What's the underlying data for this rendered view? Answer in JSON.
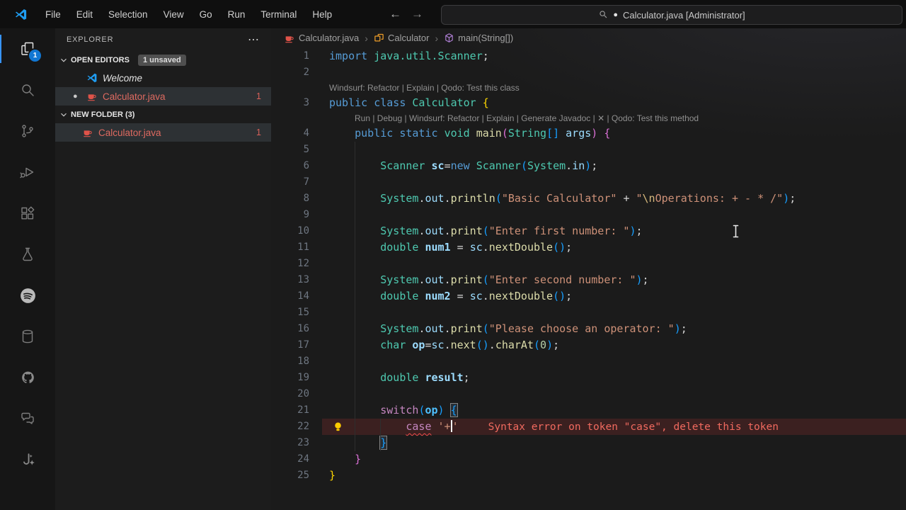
{
  "colors": {
    "accent_blue": "#3794ff",
    "badge_blue": "#1177d3",
    "error_red": "#f14c4c",
    "error_file": "#df6a60",
    "string_orange": "#ce9178",
    "keyword_blue": "#569cd6",
    "type_teal": "#4ec9b0"
  },
  "title_bar": {
    "menus": [
      "File",
      "Edit",
      "Selection",
      "View",
      "Go",
      "Run",
      "Terminal",
      "Help"
    ],
    "nav_back": "←",
    "nav_forward": "→",
    "search": {
      "icon": "search-icon",
      "dot": "●",
      "label": "Calculator.java [Administrator]"
    }
  },
  "activity_bar": {
    "items": [
      {
        "name": "explorer",
        "active": true,
        "badge": "1"
      },
      {
        "name": "search"
      },
      {
        "name": "source-control"
      },
      {
        "name": "run-debug"
      },
      {
        "name": "extensions"
      },
      {
        "name": "testing"
      },
      {
        "name": "spotify"
      },
      {
        "name": "database"
      },
      {
        "name": "github"
      },
      {
        "name": "comments"
      },
      {
        "name": "ai-assistant"
      }
    ]
  },
  "sidebar": {
    "title": "EXPLORER",
    "actions": "⋯",
    "open_editors": {
      "label": "OPEN EDITORS",
      "badge": "1 unsaved",
      "items": [
        {
          "label": "Welcome",
          "icon": "vscode",
          "italic": true
        },
        {
          "label": "Calculator.java",
          "icon": "java",
          "modified": true,
          "error": true,
          "count": "1",
          "selected": true
        }
      ]
    },
    "folder": {
      "label": "NEW FOLDER (3)",
      "items": [
        {
          "label": "Calculator.java",
          "icon": "java",
          "error": true,
          "count": "1",
          "selected": true
        }
      ]
    }
  },
  "breadcrumb": {
    "items": [
      {
        "icon": "java",
        "label": "Calculator.java"
      },
      {
        "icon": "class",
        "label": "Calculator"
      },
      {
        "icon": "method",
        "label": "main(String[])"
      }
    ]
  },
  "editor": {
    "rows": [
      {
        "n": "1",
        "t": [
          [
            "import",
            "kw"
          ],
          [
            " ",
            "p"
          ],
          [
            "java.util.Scanner",
            "type"
          ],
          [
            ";",
            "p"
          ]
        ]
      },
      {
        "n": "2",
        "t": []
      },
      {
        "lens": "Windsurf: Refactor | Explain | Qodo: Test this class",
        "indent": 0
      },
      {
        "n": "3",
        "t": [
          [
            "public",
            "kw"
          ],
          [
            " ",
            "p"
          ],
          [
            "class",
            "kw"
          ],
          [
            " ",
            "p"
          ],
          [
            "Calculator",
            "type"
          ],
          [
            " ",
            "p"
          ],
          [
            "{",
            "b1"
          ]
        ]
      },
      {
        "lens": "Run | Debug | Windsurf: Refactor | Explain | Generate Javadoc | ✕ | Qodo: Test this method",
        "indent": 4
      },
      {
        "n": "4",
        "t": [
          [
            "    ",
            "p"
          ],
          [
            "public",
            "kw"
          ],
          [
            " ",
            "p"
          ],
          [
            "static",
            "kw"
          ],
          [
            " ",
            "p"
          ],
          [
            "void",
            "type"
          ],
          [
            " ",
            "p"
          ],
          [
            "main",
            "fn"
          ],
          [
            "(",
            "b2"
          ],
          [
            "String",
            "type"
          ],
          [
            "[]",
            "b3"
          ],
          [
            " ",
            "p"
          ],
          [
            "args",
            "var"
          ],
          [
            ")",
            "b2"
          ],
          [
            " ",
            "p"
          ],
          [
            "{",
            "b2"
          ]
        ]
      },
      {
        "n": "5",
        "t": []
      },
      {
        "n": "6",
        "t": [
          [
            "        ",
            "p"
          ],
          [
            "Scanner",
            "type"
          ],
          [
            " ",
            "p"
          ],
          [
            "sc",
            "decl"
          ],
          [
            "=",
            "p"
          ],
          [
            "new",
            "kw"
          ],
          [
            " ",
            "p"
          ],
          [
            "Scanner",
            "type"
          ],
          [
            "(",
            "b3"
          ],
          [
            "System",
            "type"
          ],
          [
            ".",
            "p"
          ],
          [
            "in",
            "var"
          ],
          [
            ")",
            "b3"
          ],
          [
            ";",
            "p"
          ]
        ]
      },
      {
        "n": "7",
        "t": []
      },
      {
        "n": "8",
        "t": [
          [
            "        ",
            "p"
          ],
          [
            "System",
            "type"
          ],
          [
            ".",
            "p"
          ],
          [
            "out",
            "var"
          ],
          [
            ".",
            "p"
          ],
          [
            "println",
            "fn"
          ],
          [
            "(",
            "b3"
          ],
          [
            "\"Basic Calculator\"",
            "str"
          ],
          [
            " ",
            "p"
          ],
          [
            "+",
            "p"
          ],
          [
            " ",
            "p"
          ],
          [
            "\"",
            "str"
          ],
          [
            "\\n",
            "esc"
          ],
          [
            "Operations: + - * /\"",
            "str"
          ],
          [
            ")",
            "b3"
          ],
          [
            ";",
            "p"
          ]
        ]
      },
      {
        "n": "9",
        "t": []
      },
      {
        "n": "10",
        "t": [
          [
            "        ",
            "p"
          ],
          [
            "System",
            "type"
          ],
          [
            ".",
            "p"
          ],
          [
            "out",
            "var"
          ],
          [
            ".",
            "p"
          ],
          [
            "print",
            "fn"
          ],
          [
            "(",
            "b3"
          ],
          [
            "\"Enter first number: \"",
            "str"
          ],
          [
            ")",
            "b3"
          ],
          [
            ";",
            "p"
          ]
        ]
      },
      {
        "n": "11",
        "t": [
          [
            "        ",
            "p"
          ],
          [
            "double",
            "type"
          ],
          [
            " ",
            "p"
          ],
          [
            "num1",
            "decl"
          ],
          [
            " ",
            "p"
          ],
          [
            "=",
            "p"
          ],
          [
            " ",
            "p"
          ],
          [
            "sc",
            "var"
          ],
          [
            ".",
            "p"
          ],
          [
            "nextDouble",
            "fn"
          ],
          [
            "()",
            "b3"
          ],
          [
            ";",
            "p"
          ]
        ]
      },
      {
        "n": "12",
        "t": []
      },
      {
        "n": "13",
        "t": [
          [
            "        ",
            "p"
          ],
          [
            "System",
            "type"
          ],
          [
            ".",
            "p"
          ],
          [
            "out",
            "var"
          ],
          [
            ".",
            "p"
          ],
          [
            "print",
            "fn"
          ],
          [
            "(",
            "b3"
          ],
          [
            "\"Enter second number: \"",
            "str"
          ],
          [
            ")",
            "b3"
          ],
          [
            ";",
            "p"
          ]
        ]
      },
      {
        "n": "14",
        "t": [
          [
            "        ",
            "p"
          ],
          [
            "double",
            "type"
          ],
          [
            " ",
            "p"
          ],
          [
            "num2",
            "decl"
          ],
          [
            " ",
            "p"
          ],
          [
            "=",
            "p"
          ],
          [
            " ",
            "p"
          ],
          [
            "sc",
            "var"
          ],
          [
            ".",
            "p"
          ],
          [
            "nextDouble",
            "fn"
          ],
          [
            "()",
            "b3"
          ],
          [
            ";",
            "p"
          ]
        ]
      },
      {
        "n": "15",
        "t": []
      },
      {
        "n": "16",
        "t": [
          [
            "        ",
            "p"
          ],
          [
            "System",
            "type"
          ],
          [
            ".",
            "p"
          ],
          [
            "out",
            "var"
          ],
          [
            ".",
            "p"
          ],
          [
            "print",
            "fn"
          ],
          [
            "(",
            "b3"
          ],
          [
            "\"Please choose an operator: \"",
            "str"
          ],
          [
            ")",
            "b3"
          ],
          [
            ";",
            "p"
          ]
        ]
      },
      {
        "n": "17",
        "t": [
          [
            "        ",
            "p"
          ],
          [
            "char",
            "type"
          ],
          [
            " ",
            "p"
          ],
          [
            "op",
            "decl"
          ],
          [
            "=",
            "p"
          ],
          [
            "sc",
            "var"
          ],
          [
            ".",
            "p"
          ],
          [
            "next",
            "fn"
          ],
          [
            "()",
            "b3"
          ],
          [
            ".",
            "p"
          ],
          [
            "charAt",
            "fn"
          ],
          [
            "(",
            "b3"
          ],
          [
            "0",
            "num"
          ],
          [
            ")",
            "b3"
          ],
          [
            ";",
            "p"
          ]
        ]
      },
      {
        "n": "18",
        "t": []
      },
      {
        "n": "19",
        "t": [
          [
            "        ",
            "p"
          ],
          [
            "double",
            "type"
          ],
          [
            " ",
            "p"
          ],
          [
            "result",
            "decl"
          ],
          [
            ";",
            "p"
          ]
        ]
      },
      {
        "n": "20",
        "t": []
      },
      {
        "n": "21",
        "t": [
          [
            "        ",
            "p"
          ],
          [
            "switch",
            "ctrl"
          ],
          [
            "(",
            "b3"
          ],
          [
            "op",
            "varb"
          ],
          [
            ")",
            "b3"
          ],
          [
            " ",
            "p"
          ],
          [
            "{",
            "b3 mb"
          ]
        ]
      },
      {
        "n": "22",
        "err": true,
        "bulb": true,
        "t": [
          [
            "            ",
            "p"
          ],
          [
            "case",
            "caseerr"
          ],
          [
            " ",
            "p"
          ],
          [
            "'+",
            "str"
          ],
          [
            "",
            "caret"
          ],
          [
            "'",
            "str"
          ]
        ],
        "msg": "Syntax error on token \"case\", delete this token"
      },
      {
        "n": "23",
        "t": [
          [
            "        ",
            "p"
          ],
          [
            "}",
            "b3 mb"
          ]
        ]
      },
      {
        "n": "24",
        "t": [
          [
            "    ",
            "p"
          ],
          [
            "}",
            "b2"
          ]
        ]
      },
      {
        "n": "25",
        "t": [
          [
            "}",
            "b1"
          ]
        ]
      }
    ]
  }
}
